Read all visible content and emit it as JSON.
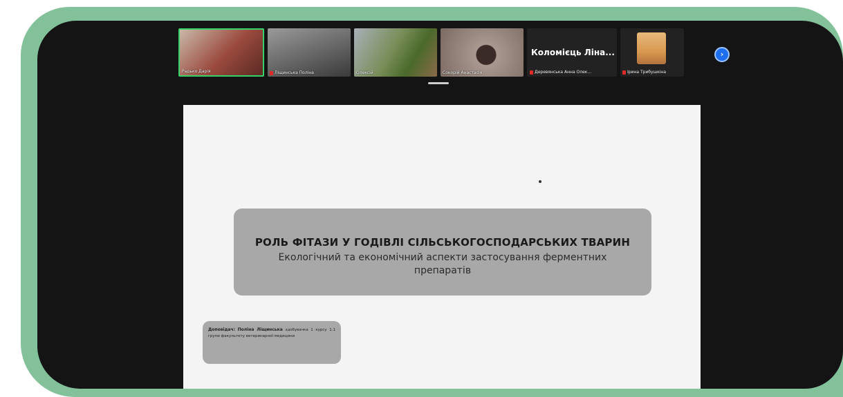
{
  "participants": [
    {
      "name": "Радько Дарія",
      "mic_muted": false,
      "active": true,
      "bg": "#8e3a3a"
    },
    {
      "name": "Ліщинська Поліна",
      "mic_muted": true,
      "active": false,
      "bg": "#6e6e6e"
    },
    {
      "name": "Олексій",
      "mic_muted": false,
      "active": false,
      "bg": "#7a8a6a"
    },
    {
      "name": "Сокорій Анастасія",
      "mic_muted": false,
      "active": false,
      "bg": "#8a7a70"
    }
  ],
  "name_tile": {
    "display_name": "Коломієць Ліна...",
    "caption": "Деревянська Анна Олек..."
  },
  "photo_tile": {
    "caption": "Ірина Трибушкіна"
  },
  "slide": {
    "title": "РОЛЬ ФІТАЗИ У ГОДІВЛІ СІЛЬСЬКОГОСПОДАРСЬКИХ ТВАРИН",
    "subtitle": "Екологічний та економічний аспекти застосування ферментних препаратів",
    "author_label": "Доповідач:",
    "author_name": "Поліна Ліщинська",
    "author_details": "здобувачка 1 курсу 1.1 групи факультету ветеринарної медицини"
  },
  "colors": {
    "frame": "#83c19a",
    "screen": "#141414",
    "slide_bg": "#f4f4f4",
    "box_bg": "#a8a8a8",
    "active_border": "#35d36a",
    "next_button": "#1d6ef0"
  },
  "icons": {
    "next": "chevron-right-icon",
    "mic": "mic-off-icon"
  }
}
